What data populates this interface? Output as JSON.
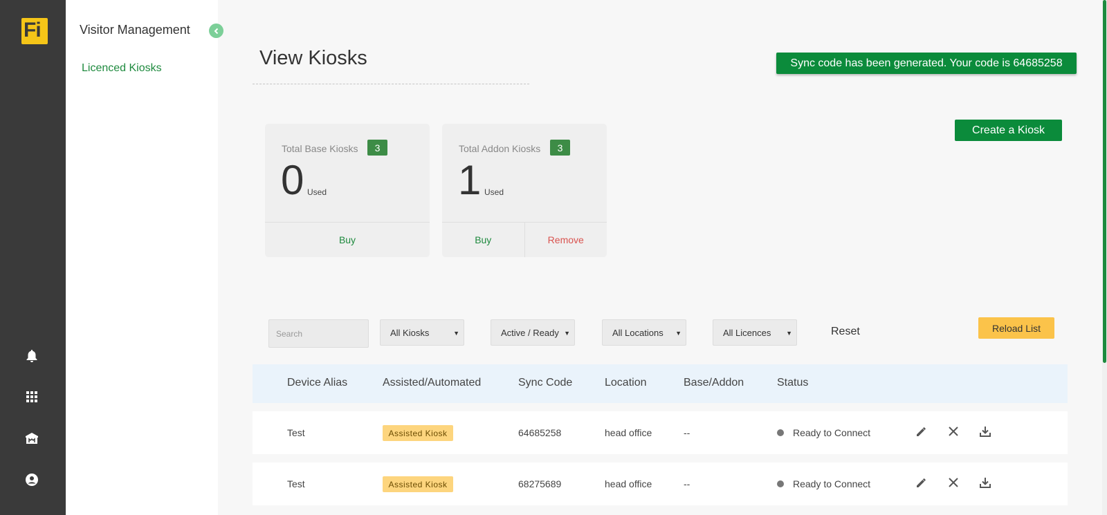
{
  "app": {
    "logo_text": "Fi",
    "brand_color": "#f5c518",
    "accent_color": "#0b8b3b"
  },
  "leftbar": {
    "icons": [
      "bell-icon",
      "grid-icon",
      "building-icon",
      "user-icon"
    ]
  },
  "sidebar": {
    "title": "Visitor Management",
    "items": [
      {
        "label": "Licenced Kiosks",
        "active": true
      }
    ]
  },
  "header": {
    "title": "View Kiosks"
  },
  "toast": {
    "message": "Sync code has been generated. Your code is 64685258"
  },
  "actions": {
    "create_label": "Create a Kiosk"
  },
  "cards": [
    {
      "label": "Total Base Kiosks",
      "total": "3",
      "used": "0",
      "used_label": "Used",
      "buy_label": "Buy"
    },
    {
      "label": "Total Addon Kiosks",
      "total": "3",
      "used": "1",
      "used_label": "Used",
      "buy_label": "Buy",
      "remove_label": "Remove"
    }
  ],
  "filters": {
    "search_placeholder": "Search",
    "kiosks": "All Kiosks",
    "status": "Active / Ready",
    "locations": "All Locations",
    "licences": "All Licences",
    "reset_label": "Reset",
    "reload_label": "Reload List"
  },
  "table": {
    "headers": [
      "Device Alias",
      "Assisted/Automated",
      "Sync Code",
      "Location",
      "Base/Addon",
      "Status"
    ],
    "rows": [
      {
        "alias": "Test",
        "type": "Assisted Kiosk",
        "sync_code": "64685258",
        "location": "head office",
        "base_addon": "--",
        "status": "Ready to Connect"
      },
      {
        "alias": "Test",
        "type": "Assisted Kiosk",
        "sync_code": "68275689",
        "location": "head office",
        "base_addon": "--",
        "status": "Ready to Connect"
      }
    ]
  }
}
